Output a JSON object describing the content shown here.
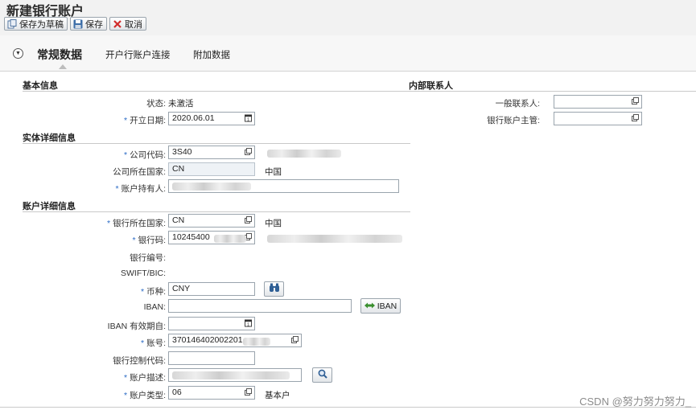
{
  "page": {
    "title": "新建银行账户"
  },
  "toolbar": {
    "save_draft": "保存为草稿",
    "save": "保存",
    "cancel": "取消"
  },
  "tabs": [
    {
      "label": "常规数据",
      "active": true
    },
    {
      "label": "开户行账户连接",
      "active": false
    },
    {
      "label": "附加数据",
      "active": false
    }
  ],
  "sections": {
    "basic": "基本信息",
    "entity": "实体详细信息",
    "account": "账户详细信息",
    "internal": "内部联系人"
  },
  "fields": {
    "status_label": "状态:",
    "status_value": "未激活",
    "open_date_label": "开立日期:",
    "open_date_value": "2020.06.01",
    "company_code_label": "公司代码:",
    "company_code_value": "3S40",
    "company_country_label": "公司所在国家:",
    "company_country_value": "CN",
    "company_country_text": "中国",
    "holder_label": "账户持有人:",
    "holder_value": "",
    "bank_country_label": "银行所在国家:",
    "bank_country_value": "CN",
    "bank_country_text": "中国",
    "bank_code_label": "银行码:",
    "bank_code_value": "10245400",
    "bank_number_label": "银行编号:",
    "swift_label": "SWIFT/BIC:",
    "currency_label": "币种:",
    "currency_value": "CNY",
    "iban_label": "IBAN:",
    "iban_value": "",
    "iban_button": "IBAN",
    "iban_valid_label": "IBAN 有效期自:",
    "iban_valid_value": "",
    "account_no_label": "账号:",
    "account_no_value": "370146402002201",
    "control_key_label": "银行控制代码:",
    "control_key_value": "",
    "account_desc_label": "账户描述:",
    "account_desc_value": "",
    "account_type_label": "账户类型:",
    "account_type_value": "06",
    "account_type_text": "基本户",
    "contact_label": "一般联系人:",
    "contact_value": "",
    "manager_label": "银行账户主管:",
    "manager_value": ""
  },
  "watermark": "CSDN @努力努力努力_",
  "colors": {
    "required": "#2a6ac5",
    "header_bg": "#f2f2f2",
    "readonly_bg": "#eef2f6"
  }
}
